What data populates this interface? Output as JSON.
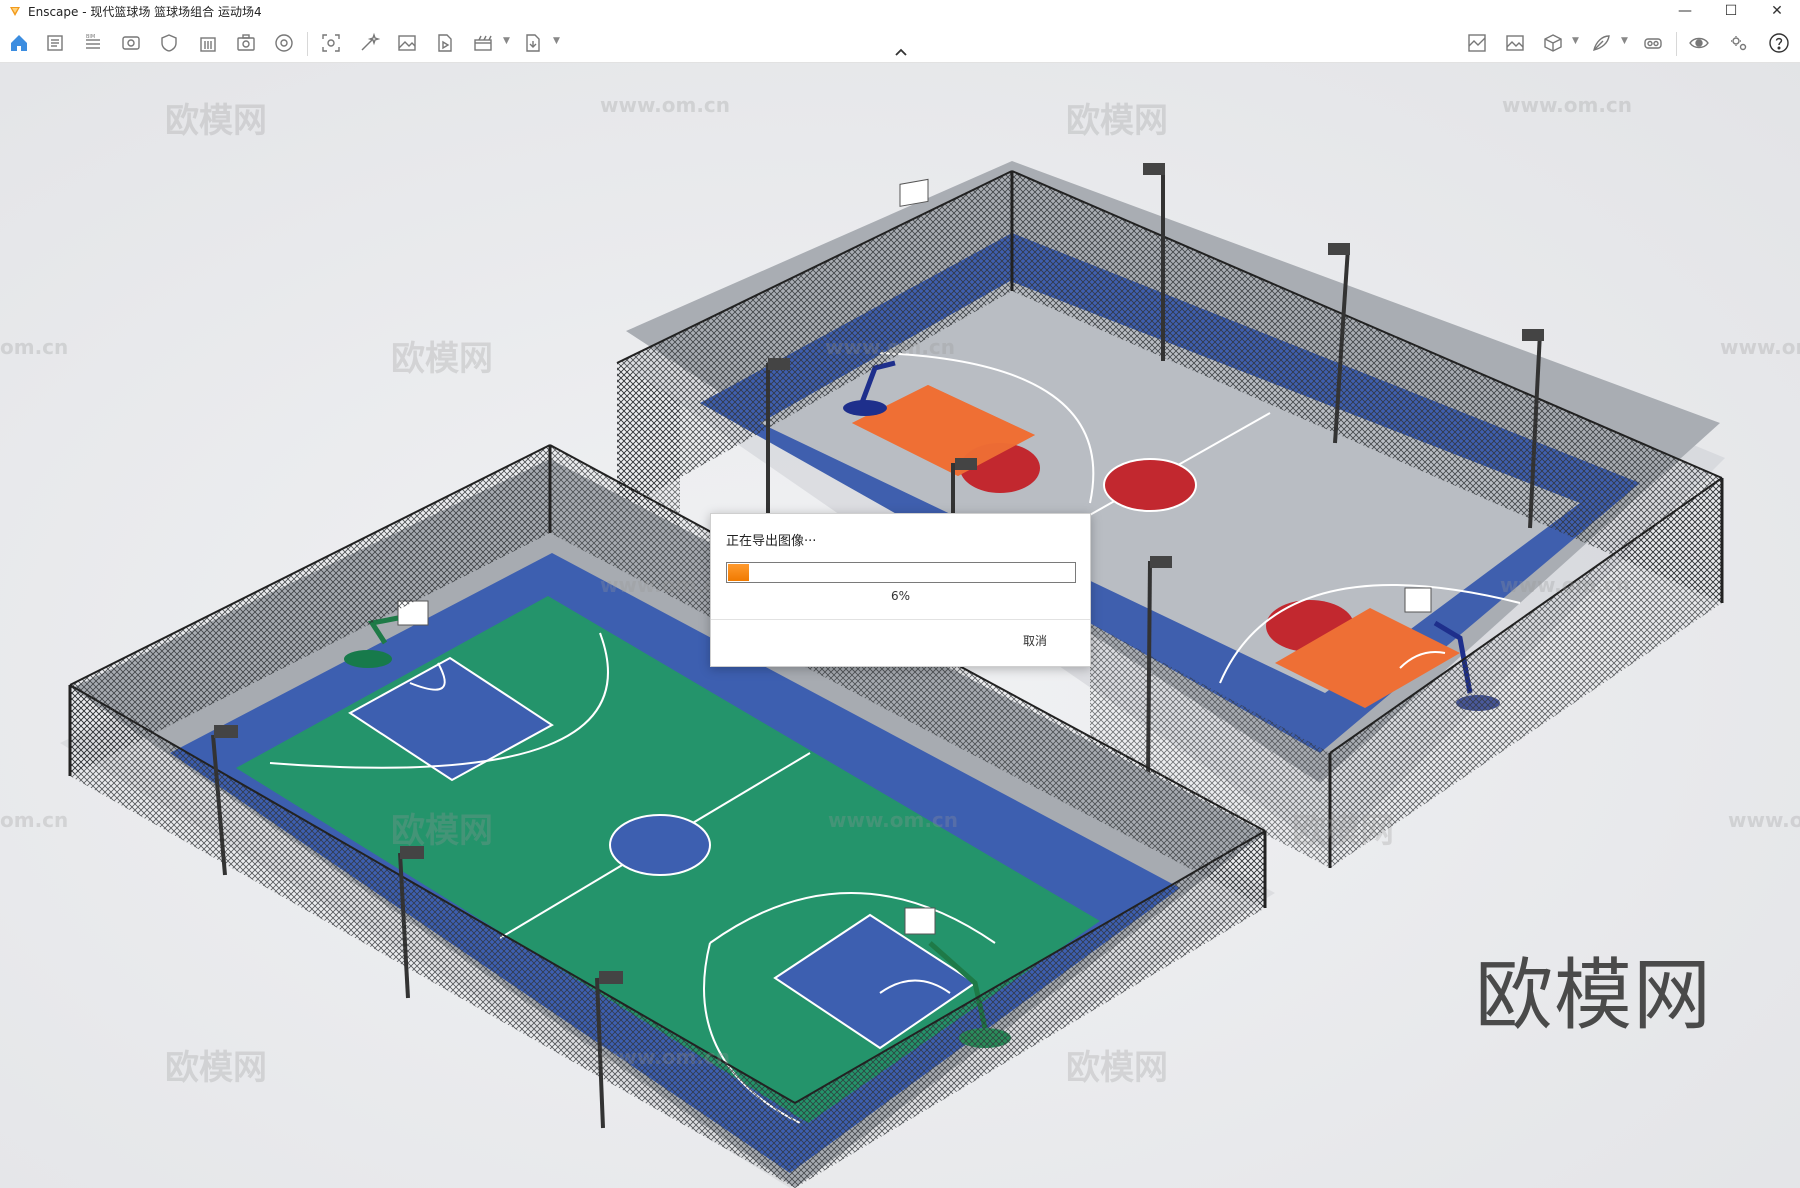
{
  "window": {
    "title": "Enscape - 现代篮球场 篮球场组合 运动场4",
    "minimize": "—",
    "maximize": "☐",
    "close": "✕"
  },
  "toolbar": {
    "left_icons": [
      "home-icon",
      "document-icon",
      "bim-icon",
      "view-icon",
      "shield-icon",
      "building-icon",
      "photo-export-icon",
      "panorama-icon",
      "screenshot-icon",
      "magic-icon",
      "image-icon",
      "video-icon",
      "batch-export-icon",
      "file-export-icon"
    ],
    "right_icons": [
      "asset-library-icon",
      "gallery-icon",
      "cube-icon",
      "feather-icon",
      "vr-headset-icon",
      "eye-icon",
      "settings-icon",
      "help-icon"
    ]
  },
  "watermarks": {
    "logo_text": "欧模网",
    "url_text": "www.om.cn",
    "url_partial": "om.cn",
    "big_text": "欧模网"
  },
  "dialog": {
    "message": "正在导出图像···",
    "progress": 0.06,
    "percent_label": "6%",
    "cancel_label": "取消"
  },
  "colors": {
    "accent": "#ff8a1a",
    "court_green": "#24946b",
    "court_blue": "#3d5fb0",
    "court_orange": "#ee6f35",
    "court_red": "#c2282f",
    "court_gray": "#b8bcc2"
  }
}
